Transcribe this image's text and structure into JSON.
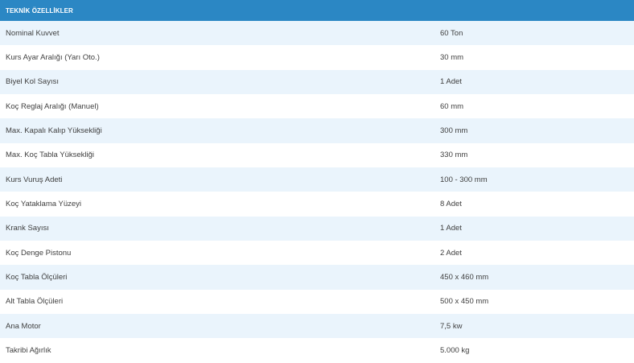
{
  "header": {
    "title": "TEKNİK ÖZELLİKLER"
  },
  "rows": [
    {
      "label": "Nominal Kuvvet",
      "value": "60 Ton"
    },
    {
      "label": "Kurs Ayar Aralığı (Yarı Oto.)",
      "value": "30 mm"
    },
    {
      "label": "Biyel Kol Sayısı",
      "value": "1 Adet"
    },
    {
      "label": "Koç Reglaj Aralığı (Manuel)",
      "value": "60 mm"
    },
    {
      "label": "Max. Kapalı Kalıp Yüksekliği",
      "value": "300 mm"
    },
    {
      "label": "Max. Koç Tabla Yüksekliği",
      "value": "330 mm"
    },
    {
      "label": "Kurs Vuruş Adeti",
      "value": "100 - 300 mm"
    },
    {
      "label": "Koç Yataklama Yüzeyi",
      "value": "8 Adet"
    },
    {
      "label": "Krank Sayısı",
      "value": "1 Adet"
    },
    {
      "label": "Koç Denge Pistonu",
      "value": "2 Adet"
    },
    {
      "label": "Koç Tabla Ölçüleri",
      "value": "450 x 460 mm"
    },
    {
      "label": "Alt Tabla Ölçüleri",
      "value": "500 x 450 mm"
    },
    {
      "label": "Ana Motor",
      "value": "7,5 kw"
    },
    {
      "label": "Takribi Ağırlık",
      "value": "5.000 kg"
    }
  ]
}
